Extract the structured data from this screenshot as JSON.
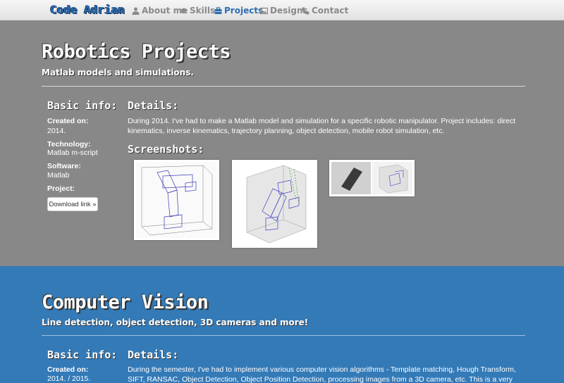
{
  "nav": {
    "brand": "Code Adrian",
    "links": [
      {
        "label": "About me",
        "icon": "user-icon"
      },
      {
        "label": "Skills",
        "icon": "graduation-cap-icon"
      },
      {
        "label": "Projects",
        "icon": "briefcase-icon",
        "active": true
      },
      {
        "label": "Designs",
        "icon": "picture-icon"
      },
      {
        "label": "Contact",
        "icon": "phone-icon"
      }
    ]
  },
  "robotics": {
    "title": "Robotics Projects",
    "subtitle": "Matlab models and simulations.",
    "basic_info_heading": "Basic info:",
    "created_label": "Created on:",
    "created_value": "2014.",
    "technology_label": "Technology:",
    "technology_value": "Matlab m-script",
    "software_label": "Software:",
    "software_value": "Matlab",
    "project_label": "Project:",
    "download_label": "Download link »",
    "details_heading": "Details:",
    "details_text": "During 2014. I've had to make a Matlab model and simulation for a specific robotic manipulator. Project includes: direct kinematics, inverse kinematics, trajectory planning, object detection, mobile robot simulation, etc.",
    "screenshots_heading": "Screenshots:"
  },
  "vision": {
    "title": "Computer Vision",
    "subtitle": "Line detection, object detection, 3D cameras and more!",
    "basic_info_heading": "Basic info:",
    "created_label": "Created on:",
    "created_value": "2014. / 2015.",
    "details_heading": "Details:",
    "details_text": "During the semester, I've had to implement various computer vision algorithms - Template matching, Hough Transform, SIFT, RANSAC, Object Detection, Object Position Detection, processing images from a 3D camera, etc. This is a very complex field of study"
  },
  "colors": {
    "grey_section": "#888888",
    "blue_section": "#337ab7",
    "nav_active": "#2a6db3"
  }
}
